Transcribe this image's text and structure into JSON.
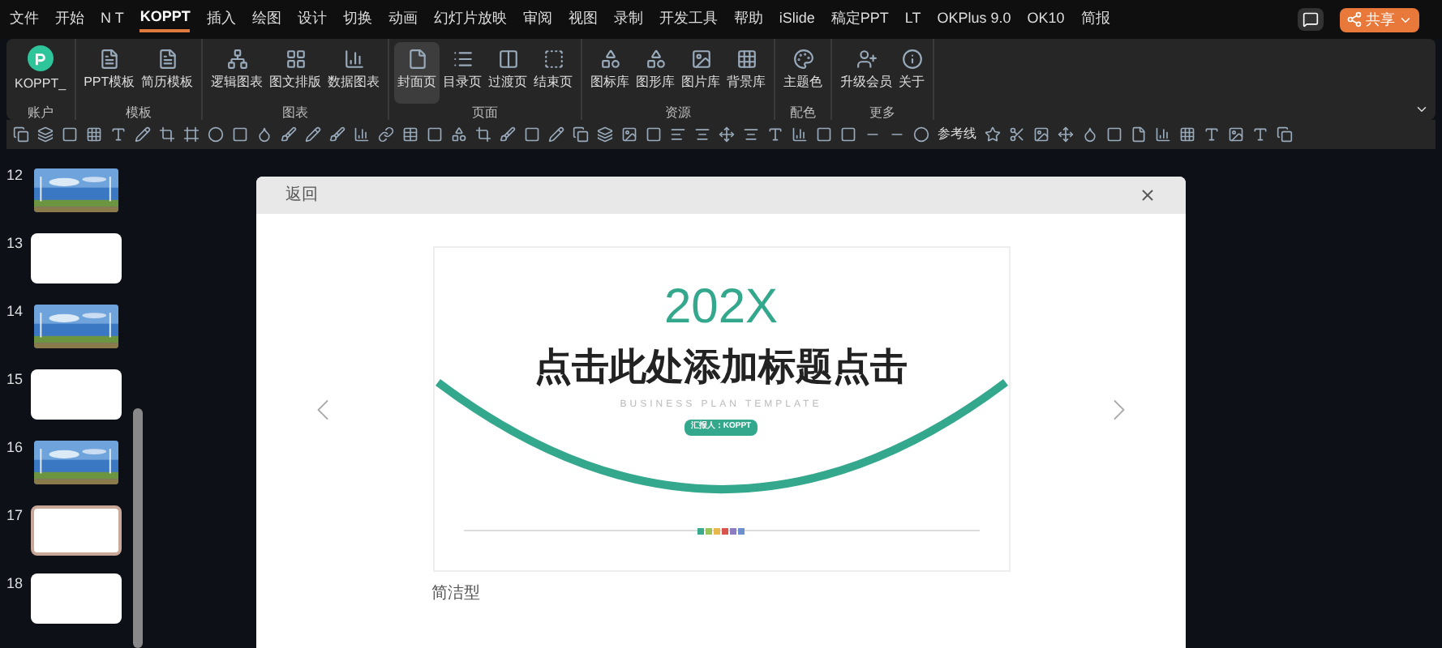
{
  "menu": [
    {
      "label": "文件",
      "selected": false
    },
    {
      "label": "开始",
      "selected": false
    },
    {
      "label": "N T",
      "selected": false
    },
    {
      "label": "KOPPT",
      "selected": true
    },
    {
      "label": "插入",
      "selected": false
    },
    {
      "label": "绘图",
      "selected": false
    },
    {
      "label": "设计",
      "selected": false
    },
    {
      "label": "切换",
      "selected": false
    },
    {
      "label": "动画",
      "selected": false
    },
    {
      "label": "幻灯片放映",
      "selected": false
    },
    {
      "label": "审阅",
      "selected": false
    },
    {
      "label": "视图",
      "selected": false
    },
    {
      "label": "录制",
      "selected": false
    },
    {
      "label": "开发工具",
      "selected": false
    },
    {
      "label": "帮助",
      "selected": false
    },
    {
      "label": "iSlide",
      "selected": false
    },
    {
      "label": "稿定PPT",
      "selected": false
    },
    {
      "label": "LT",
      "selected": false
    },
    {
      "label": "OKPlus 9.0",
      "selected": false
    },
    {
      "label": "OK10",
      "selected": false
    },
    {
      "label": "简报",
      "selected": false
    }
  ],
  "share_button": "共享",
  "ribbon": [
    {
      "group": "账户",
      "buttons": [
        {
          "label": "KOPPT_",
          "selected": false
        }
      ]
    },
    {
      "group": "模板",
      "buttons": [
        {
          "label": "PPT模板",
          "selected": false
        },
        {
          "label": "简历模板",
          "selected": false
        }
      ]
    },
    {
      "group": "图表",
      "buttons": [
        {
          "label": "逻辑图表",
          "selected": false
        },
        {
          "label": "图文排版",
          "selected": false
        },
        {
          "label": "数据图表",
          "selected": false
        }
      ]
    },
    {
      "group": "页面",
      "buttons": [
        {
          "label": "封面页",
          "selected": true
        },
        {
          "label": "目录页",
          "selected": false
        },
        {
          "label": "过渡页",
          "selected": false
        },
        {
          "label": "结束页",
          "selected": false
        }
      ]
    },
    {
      "group": "资源",
      "buttons": [
        {
          "label": "图标库",
          "selected": false
        },
        {
          "label": "图形库",
          "selected": false
        },
        {
          "label": "图片库",
          "selected": false
        },
        {
          "label": "背景库",
          "selected": false
        }
      ]
    },
    {
      "group": "配色",
      "buttons": [
        {
          "label": "主题色",
          "selected": false
        }
      ]
    },
    {
      "group": "更多",
      "buttons": [
        {
          "label": "升级会员",
          "selected": false
        },
        {
          "label": "关于",
          "selected": false
        }
      ]
    }
  ],
  "toolbar_label": "参考线",
  "slides": [
    {
      "number": "12",
      "kind": "picture",
      "selected": false
    },
    {
      "number": "13",
      "kind": "blank",
      "selected": false
    },
    {
      "number": "14",
      "kind": "picture",
      "selected": false
    },
    {
      "number": "15",
      "kind": "blank",
      "selected": false
    },
    {
      "number": "16",
      "kind": "picture",
      "selected": false
    },
    {
      "number": "17",
      "kind": "blank",
      "selected": true
    },
    {
      "number": "18",
      "kind": "blank",
      "selected": false
    }
  ],
  "dialog": {
    "back": "返回",
    "preview": {
      "year": "202X",
      "title": "点击此处添加标题点击",
      "subtitle": "BUSINESS PLAN TEMPLATE",
      "presenter": "汇报人：KOPPT",
      "dots": [
        {
          "color": "#3aa98c"
        },
        {
          "color": "#9ac35a"
        },
        {
          "color": "#e8b84a"
        },
        {
          "color": "#d9534f"
        },
        {
          "color": "#8e7cc3"
        },
        {
          "color": "#6d8fd0"
        }
      ]
    },
    "caption": "简洁型"
  }
}
